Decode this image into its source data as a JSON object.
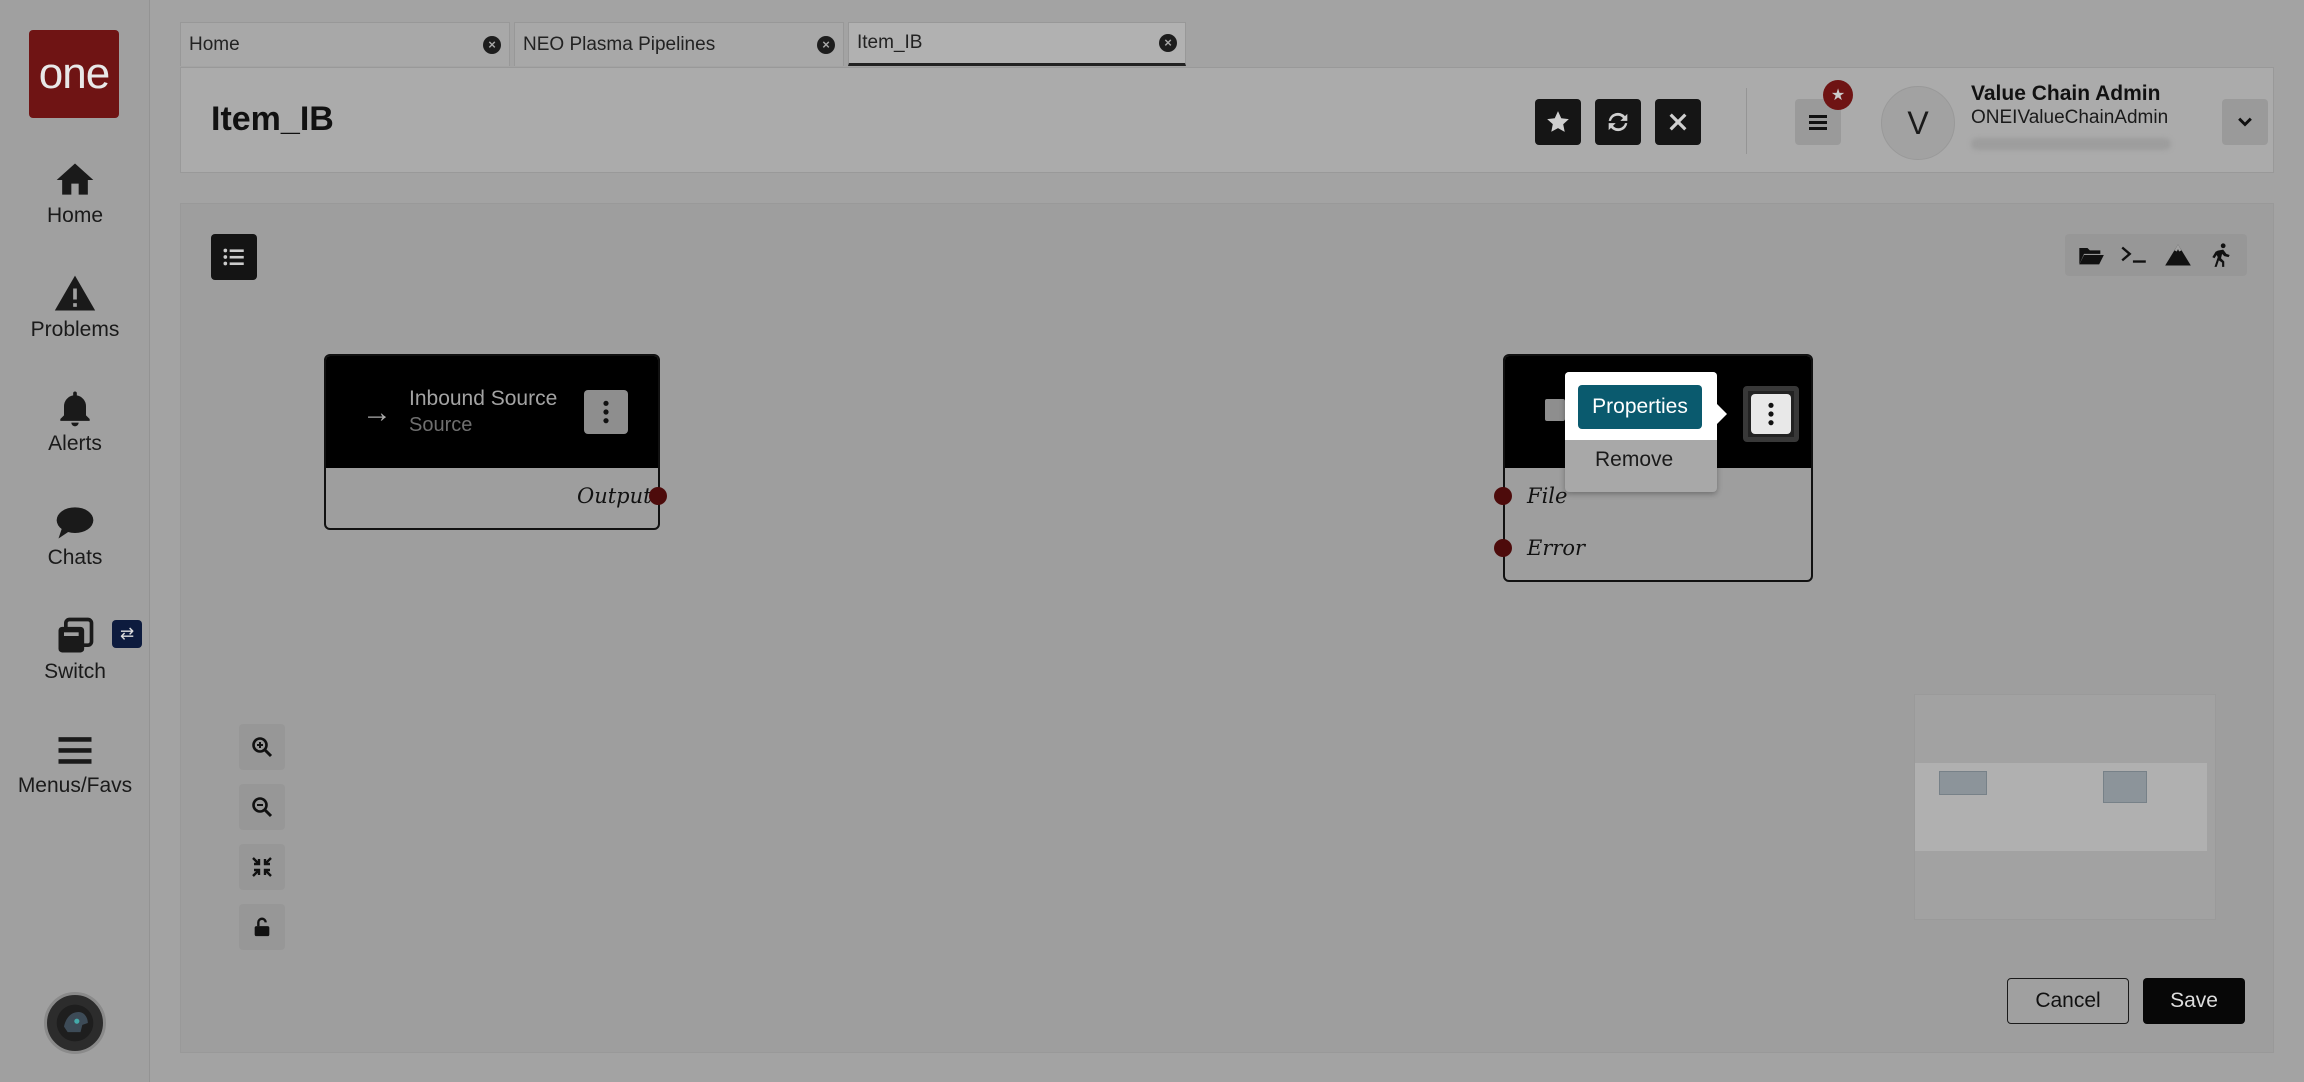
{
  "logo": {
    "text": "one"
  },
  "sidebar": {
    "items": [
      {
        "label": "Home",
        "icon": "home-icon"
      },
      {
        "label": "Problems",
        "icon": "warning-icon"
      },
      {
        "label": "Alerts",
        "icon": "bell-icon"
      },
      {
        "label": "Chats",
        "icon": "chat-icon"
      },
      {
        "label": "Switch",
        "icon": "switch-icon"
      },
      {
        "label": "Menus/Favs",
        "icon": "menu-icon"
      }
    ],
    "switch_badge": "⇄"
  },
  "tabs": [
    {
      "label": "Home"
    },
    {
      "label": "NEO Plasma Pipelines"
    },
    {
      "label": "Item_IB",
      "active": true
    }
  ],
  "header": {
    "title": "Item_IB",
    "user_initial": "V",
    "user_name": "Value Chain Admin",
    "user_id": "ONEIValueChainAdmin"
  },
  "canvas": {
    "source_node": {
      "title": "Inbound Source",
      "subtitle": "Source",
      "output_label": "Output"
    },
    "target_node": {
      "ports": [
        "File",
        "Error"
      ]
    },
    "context_menu": {
      "items": [
        "Properties",
        "Remove"
      ]
    }
  },
  "actions": {
    "cancel": "Cancel",
    "save": "Save"
  },
  "colors": {
    "brand": "#6f1414",
    "accent": "#0a5a6e",
    "port": "#4d0b0b"
  }
}
